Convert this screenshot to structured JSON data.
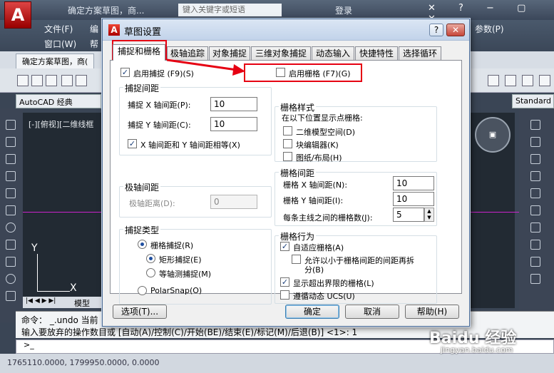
{
  "background": {
    "title_text": "确定方案草图，商...",
    "search_placeholder": "键入关键字或短语",
    "login": "登录",
    "menus": [
      "文件(F)",
      "编",
      "窗口(W)",
      "帮",
      "参数(P)"
    ],
    "doc_tab": "确定方案草图，商(",
    "workspace": "AutoCAD 经典",
    "style_name": "Standard",
    "view_label": "[-][俯视][二维线框",
    "ucs_y": "Y",
    "ucs_x": "X",
    "model_tab": "模型",
    "cmd_line1": "命令： _.undo 当前",
    "cmd_line2": "输入要放弃的操作数目或 [自动(A)/控制(C)/开始(BE)/结束(E)/标记(M)/后退(B)] <1>: 1",
    "cmd_prompt": ">_",
    "coords": "1765110.0000, 1799950.0000, 0.0000",
    "watermark": "Baidu 经验",
    "watermark_sub": "jingyan.baidu.com"
  },
  "dialog": {
    "title": "草图设置",
    "help_button": "?",
    "close_button": "✕",
    "tabs": [
      "捕捉和栅格",
      "极轴追踪",
      "对象捕捉",
      "三维对象捕捉",
      "动态输入",
      "快捷特性",
      "选择循环"
    ],
    "active_tab": 0,
    "snap_on": {
      "label": "启用捕捉 (F9)(S)",
      "checked": true
    },
    "grid_on": {
      "label": "启用栅格 (F7)(G)",
      "checked": false
    },
    "snap_spacing": {
      "title": "捕捉间距",
      "x_label": "捕捉 X 轴间距(P):",
      "x_value": "10",
      "y_label": "捕捉 Y 轴间距(C):",
      "y_value": "10",
      "equal_label": "X 轴间距和 Y 轴间距相等(X)",
      "equal_checked": true
    },
    "polar_spacing": {
      "title": "极轴间距",
      "distance_label": "极轴距离(D):",
      "distance_value": "0"
    },
    "snap_type": {
      "title": "捕捉类型",
      "grid_snap": "栅格捕捉(R)",
      "rect_snap": "矩形捕捉(E)",
      "iso_snap": "等轴测捕捉(M)",
      "polar_snap": "PolarSnap(O)"
    },
    "grid_style": {
      "title": "栅格样式",
      "subtitle": "在以下位置显示点栅格:",
      "items": [
        "二维模型空间(D)",
        "块编辑器(K)",
        "图纸/布局(H)"
      ]
    },
    "grid_spacing": {
      "title": "栅格间距",
      "x_label": "栅格 X 轴间距(N):",
      "x_value": "10",
      "y_label": "栅格 Y 轴间距(I):",
      "y_value": "10",
      "major_label": "每条主线之间的栅格数(J):",
      "major_value": "5"
    },
    "grid_behavior": {
      "title": "栅格行为",
      "adaptive": "自适应栅格(A)",
      "subdivide_line1": "允许以小于栅格间距的间距再拆",
      "subdivide_line2": "分(B)",
      "beyond_limits": "显示超出界限的栅格(L)",
      "follow_ucs": "遵循动态 UCS(U)"
    },
    "buttons": {
      "options": "选项(T)...",
      "ok": "确定",
      "cancel": "取消",
      "help": "帮助(H)"
    }
  },
  "colors": {
    "annotation": "#e60012",
    "dialog_title_bg": "#c2d3ea",
    "canvas": "#222a33"
  }
}
